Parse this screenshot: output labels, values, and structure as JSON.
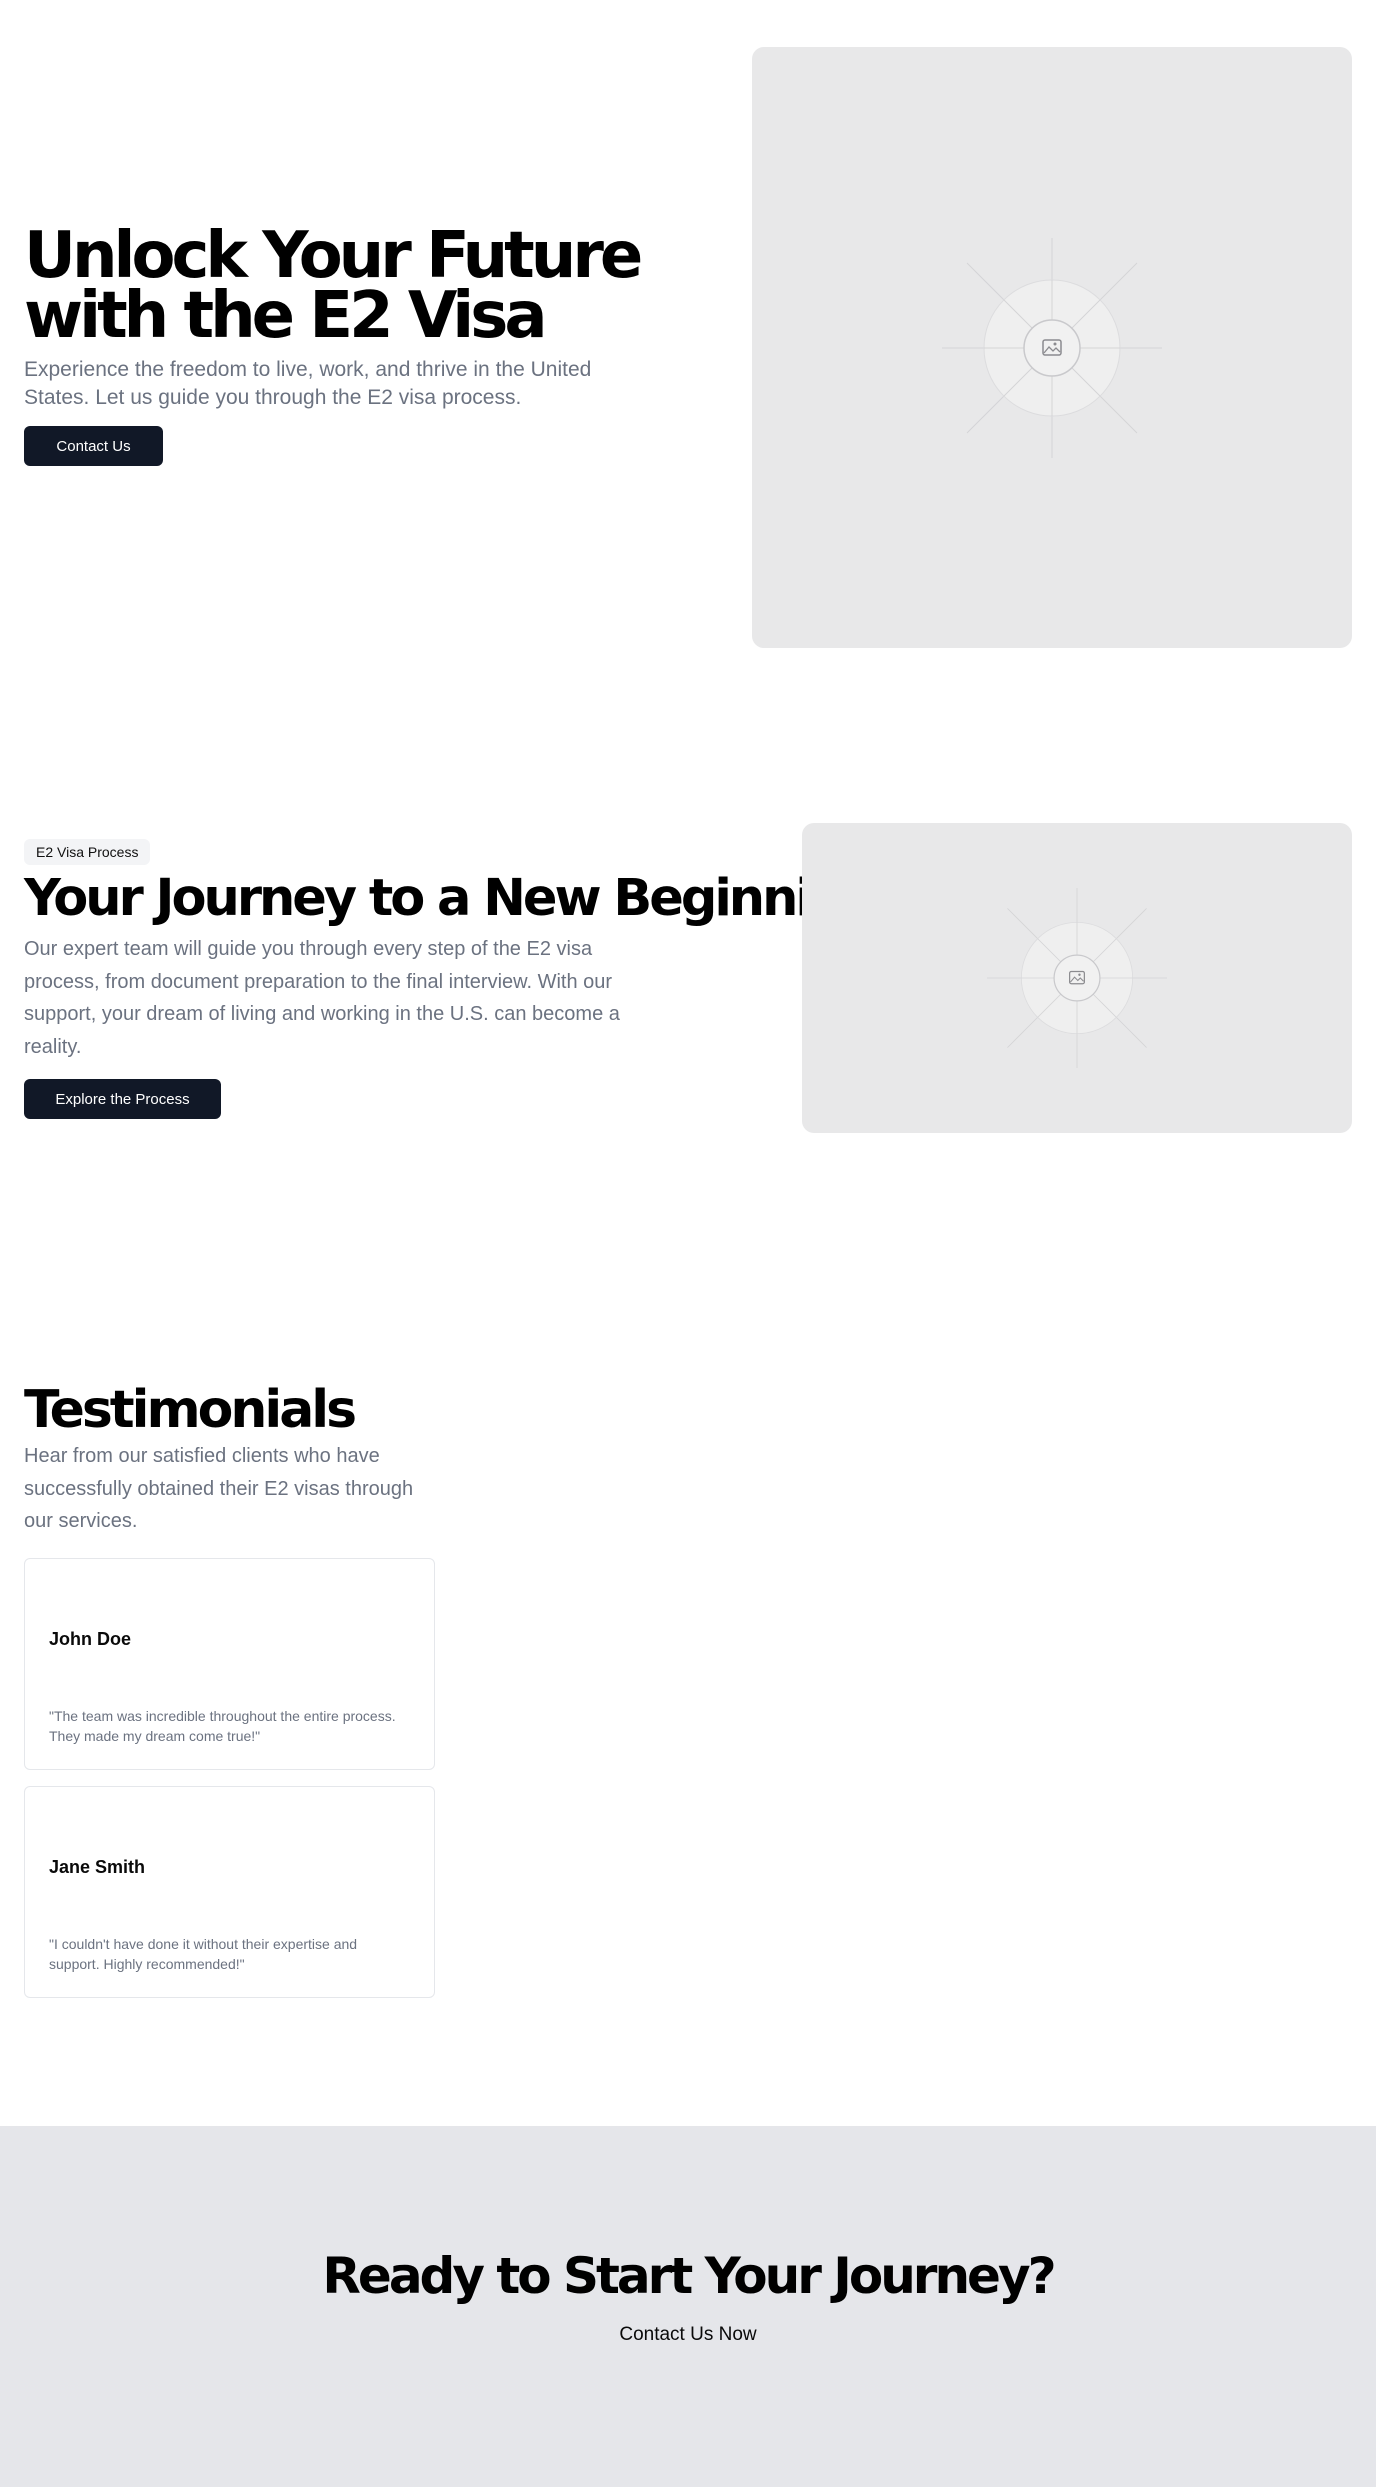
{
  "hero": {
    "title": "Unlock Your Future with the E2 Visa",
    "subtitle": "Experience the freedom to live, work, and thrive in the United States. Let us guide you through the E2 visa process.",
    "button_label": "Contact Us",
    "image_icon": "image-placeholder-icon"
  },
  "journey": {
    "badge": "E2 Visa Process",
    "title": "Your Journey to a New Beginning",
    "subtitle": "Our expert team will guide you through every step of the E2 visa process, from document preparation to the final interview. With our support, your dream of living and working in the U.S. can become a reality.",
    "button_label": "Explore the Process",
    "image_icon": "image-placeholder-icon"
  },
  "testimonials": {
    "title": "Testimonials",
    "subtitle": "Hear from our satisfied clients who have successfully obtained their E2 visas through our services.",
    "items": [
      {
        "name": "John Doe",
        "quote": "\"The team was incredible throughout the entire process. They made my dream come true!\""
      },
      {
        "name": "Jane Smith",
        "quote": "\"I couldn't have done it without their expertise and support. Highly recommended!\""
      }
    ]
  },
  "cta": {
    "title": "Ready to Start Your Journey?",
    "link_label": "Contact Us Now"
  },
  "colors": {
    "button_bg": "#111827",
    "muted_text": "#6b7280",
    "placeholder_bg": "#e8e8e9",
    "cta_bg": "#e5e6ea"
  }
}
